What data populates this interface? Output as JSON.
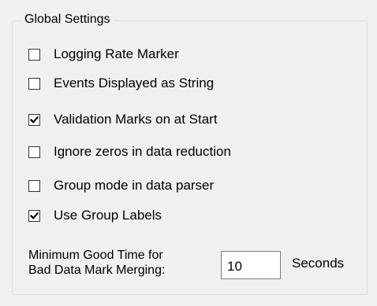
{
  "group": {
    "title": "Global Settings"
  },
  "checkboxes": [
    {
      "label": "Logging Rate Marker",
      "checked": false
    },
    {
      "label": "Events Displayed as String",
      "checked": false
    },
    {
      "label": "Validation Marks on at Start",
      "checked": true
    },
    {
      "label": "Ignore zeros in data reduction",
      "checked": false
    },
    {
      "label": "Group mode in data parser",
      "checked": false
    },
    {
      "label": "Use Group Labels",
      "checked": true
    }
  ],
  "min_good_time": {
    "label_line1": "Minimum Good Time for",
    "label_line2": "Bad Data Mark Merging:",
    "value": "10",
    "units": "Seconds"
  },
  "colors": {
    "background": "#f0f0f0",
    "frame_border": "#dcdcdc",
    "checkbox_border": "#333333",
    "check_mark": "#000000"
  }
}
